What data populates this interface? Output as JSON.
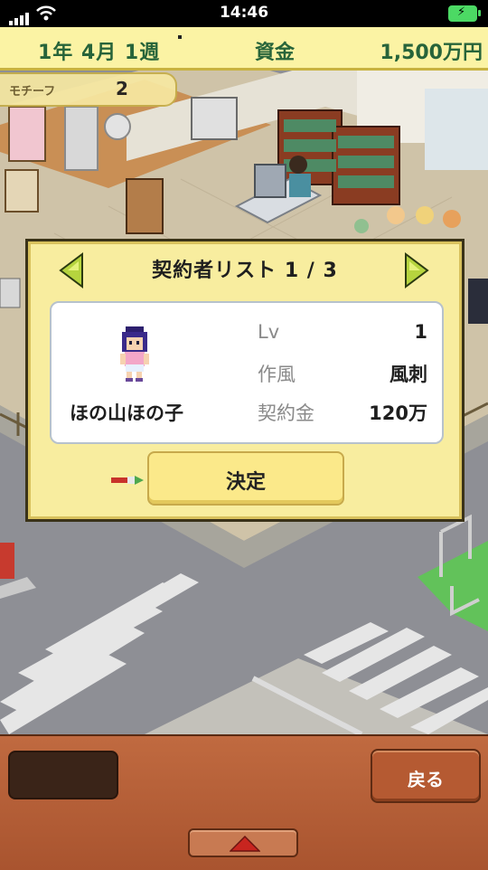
{
  "status_bar": {
    "time": "14:46"
  },
  "top_bar": {
    "date": "1年 4月 1週",
    "funds_label": "資金",
    "funds_value": "1,500万円"
  },
  "motif": {
    "label": "モチーフ",
    "count": "2"
  },
  "dialog": {
    "title": "契約者リスト 1 / 3",
    "creator": {
      "name": "ほの山ほの子",
      "rows": [
        {
          "key": "Lv",
          "value": "1"
        },
        {
          "key": "作風",
          "value": "風刺"
        },
        {
          "key": "契約金",
          "value": "120万"
        }
      ]
    },
    "confirm_label": "決定"
  },
  "bottom_bar": {
    "back_label": "戻る"
  },
  "colors": {
    "panel": "#f8ed9f",
    "accent_green": "#27643a",
    "bottom_panel": "#b8623a"
  }
}
